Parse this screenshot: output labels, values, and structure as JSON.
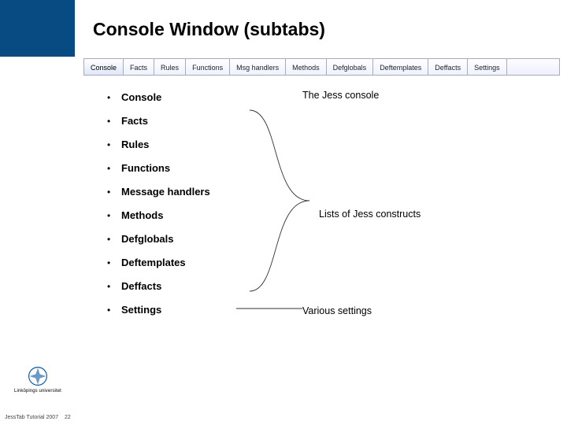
{
  "title": "Console Window (subtabs)",
  "tabs": [
    {
      "label": "Console",
      "selected": true
    },
    {
      "label": "Facts"
    },
    {
      "label": "Rules"
    },
    {
      "label": "Functions"
    },
    {
      "label": "Msg handlers"
    },
    {
      "label": "Methods"
    },
    {
      "label": "Defglobals"
    },
    {
      "label": "Deftemplates"
    },
    {
      "label": "Deffacts"
    },
    {
      "label": "Settings"
    }
  ],
  "items": [
    {
      "bullet": "•",
      "label": "Console"
    },
    {
      "bullet": "•",
      "label": "Facts"
    },
    {
      "bullet": "•",
      "label": "Rules"
    },
    {
      "bullet": "•",
      "label": "Functions"
    },
    {
      "bullet": "•",
      "label": "Message handlers"
    },
    {
      "bullet": "•",
      "label": "Methods"
    },
    {
      "bullet": "•",
      "label": "Defglobals"
    },
    {
      "bullet": "•",
      "label": "Deftemplates"
    },
    {
      "bullet": "•",
      "label": "Deffacts"
    },
    {
      "bullet": "•",
      "label": "Settings"
    }
  ],
  "annotations": {
    "console": "The Jess console",
    "constructs": "Lists of Jess constructs",
    "settings": "Various settings"
  },
  "footer": {
    "left": "JessTab Tutorial 2007",
    "page": "22",
    "university": "Linköpings universitet"
  }
}
